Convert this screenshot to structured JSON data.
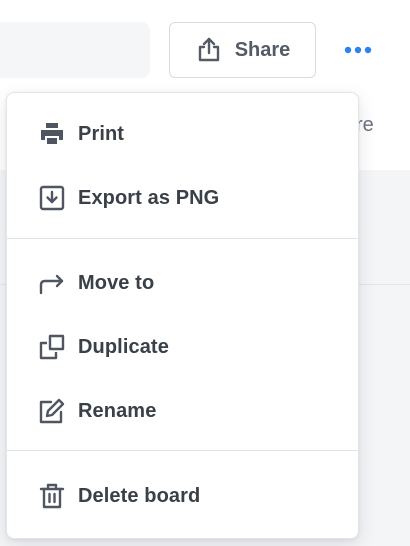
{
  "header": {
    "share_label": "Share",
    "more_icon": "more-horizontal-icon",
    "partial_label": "re"
  },
  "menu": {
    "groups": [
      [
        {
          "label": "Print",
          "icon": "print-icon"
        },
        {
          "label": "Export as PNG",
          "icon": "export-download-icon"
        }
      ],
      [
        {
          "label": "Move to",
          "icon": "move-arrow-icon"
        },
        {
          "label": "Duplicate",
          "icon": "duplicate-icon"
        },
        {
          "label": "Rename",
          "icon": "rename-edit-icon"
        }
      ],
      [
        {
          "label": "Delete board",
          "icon": "trash-icon"
        }
      ]
    ]
  },
  "colors": {
    "accent": "#2d82f0",
    "icon": "#4f5662",
    "text": "#3a4048"
  }
}
